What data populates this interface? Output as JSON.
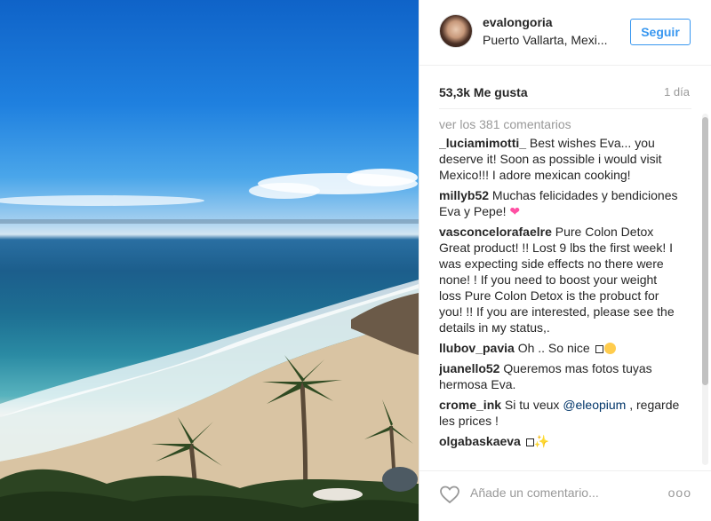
{
  "post": {
    "username": "evalongoria",
    "location": "Puerto Vallarta, Mexi...",
    "follow_label": "Seguir",
    "likes": "53,3k Me gusta",
    "time": "1 día",
    "view_all": "ver los 381 comentarios",
    "add_comment_placeholder": "Añade un comentario...",
    "more_label": "ooo"
  },
  "comments": [
    {
      "user": "_luciamimotti_",
      "text": " Best wishes Eva... you deserve it! Soon as possible i would visit Mexico!!! I adore mexican cooking!"
    },
    {
      "user": "millyb52",
      "text": " Muchas felicidades y bendiciones Eva y Pepe! "
    },
    {
      "user": "vasconcelorafaelre",
      "text": " Pure Colon Detox Great product! !! Lost 9 lbs the first week! I was expecting side effects no there were none! ! If you need to boost your weight loss Pure Colon Detox is the probuct for you! !! If you are interested, please see the details in мy status,."
    },
    {
      "user": "llubov_pavia",
      "text": " Oh .. So nice "
    },
    {
      "user": "juanello52",
      "text": " Queremos mas fotos tuyas hermosa Eva."
    },
    {
      "user": "crome_ink",
      "text_before": " Si tu veux ",
      "mention": "@eleopium",
      "text_after": " , regarde les prices !"
    },
    {
      "user": "olgabaskaeva",
      "text": " "
    }
  ],
  "colors": {
    "accent": "#3897f0",
    "muted": "#999999",
    "text": "#262626"
  },
  "icons": {
    "like": "heart-outline-icon",
    "more": "more-options-icon"
  }
}
